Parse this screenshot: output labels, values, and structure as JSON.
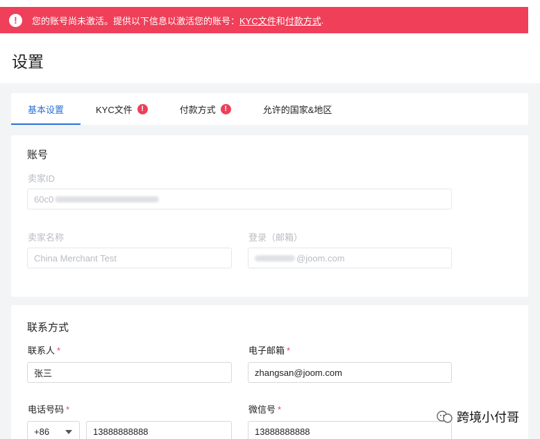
{
  "alert": {
    "message": "您的账号尚未激活。提供以下信息以激活您的账号：",
    "link_kyc": "KYC文件",
    "conjunction": "和",
    "link_payment": "付款方式",
    "end": "."
  },
  "page": {
    "title": "设置"
  },
  "tabs": [
    {
      "label": "基本设置",
      "active": true,
      "warning": false
    },
    {
      "label": "KYC文件",
      "active": false,
      "warning": true
    },
    {
      "label": "付款方式",
      "active": false,
      "warning": true
    },
    {
      "label": "允许的国家&地区",
      "active": false,
      "warning": false
    }
  ],
  "account": {
    "title": "账号",
    "merchant_id_label": "卖家ID",
    "merchant_id_value": "60c0",
    "merchant_name_label": "卖家名称",
    "merchant_name_value": "China Merchant Test",
    "login_label": "登录（邮箱）",
    "login_value": "@joom.com"
  },
  "contact": {
    "title": "联系方式",
    "contact_person_label": "联系人",
    "contact_person_value": "张三",
    "email_label": "电子邮箱",
    "email_value": "zhangsan@joom.com",
    "phone_label": "电话号码",
    "phone_code": "+86",
    "phone_value": "13888888888",
    "wechat_label": "微信号",
    "wechat_value": "13888888888",
    "required_mark": "*"
  },
  "watermark": {
    "text": "跨境小付哥"
  },
  "colors": {
    "alert": "#ef3f59",
    "accent": "#2a6fd6"
  }
}
